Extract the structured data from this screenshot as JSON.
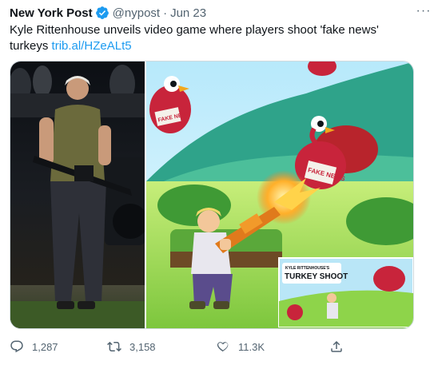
{
  "tweet": {
    "author_name": "New York Post",
    "handle": "@nypost",
    "separator": "·",
    "date": "Jun 23",
    "more_icon": "···",
    "text": "Kyle Rittenhouse unveils video game where players shoot 'fake news' turkeys",
    "link": "trib.al/HZeALt5"
  },
  "media": {
    "icons": [
      "photo",
      "game-art"
    ],
    "left_photo_alt": "",
    "game_overlay": {
      "subtitle": "KYLE RITTENHOUSE'S",
      "title": "TURKEY SHOOT"
    },
    "turkey_signs": [
      "FAKE NEWS",
      "FAKE NEWS"
    ]
  },
  "actions": {
    "reply_count": "1,287",
    "retweet_count": "3,158",
    "like_count": "11.3K"
  },
  "colors": {
    "link": "#1d9bf0",
    "verified": "#1d9bf0",
    "muted": "#536471",
    "sky": "#cfeefd",
    "grass": "#8ed44a",
    "turkey": "#c8243b"
  }
}
